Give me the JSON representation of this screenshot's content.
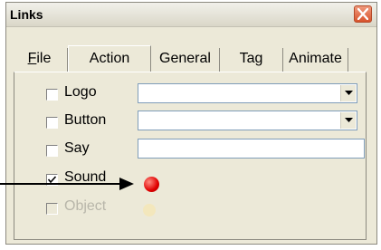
{
  "window": {
    "title": "Links"
  },
  "tabs": [
    {
      "label": "File",
      "mnemonic": "F",
      "rest": "ile"
    },
    {
      "label": "Action"
    },
    {
      "label": "General"
    },
    {
      "label": "Tag"
    },
    {
      "label": "Animate"
    }
  ],
  "rows": [
    {
      "label": "Logo",
      "checked": false,
      "field": "dropdown",
      "value": ""
    },
    {
      "label": "Button",
      "checked": false,
      "field": "dropdown",
      "value": ""
    },
    {
      "label": "Say",
      "checked": false,
      "field": "text",
      "value": ""
    },
    {
      "label": "Sound",
      "checked": true,
      "field": "indicator",
      "indicator_color": "#e00000"
    },
    {
      "label": "Object",
      "checked": false,
      "disabled": true,
      "field": "indicator",
      "indicator_color": "#f5e6b5"
    }
  ],
  "colors": {
    "background": "#ece9d8",
    "field_border": "#7f9db9",
    "close_button": "#d8532c"
  }
}
